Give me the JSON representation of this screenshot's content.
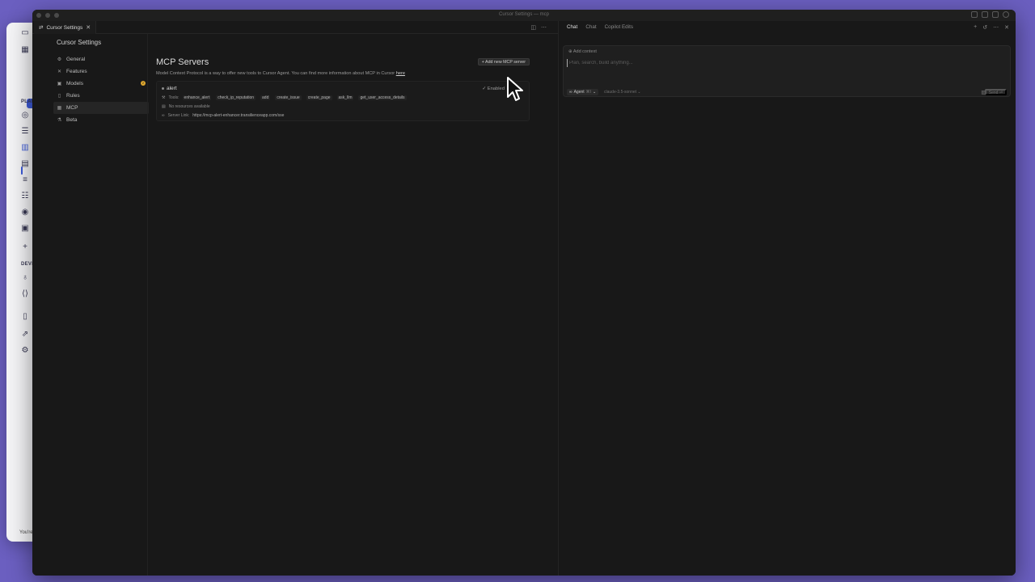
{
  "window": {
    "title": "Cursor Settings — mcp"
  },
  "editor": {
    "tab_label": "Cursor Settings",
    "tab_close": "✕"
  },
  "settings": {
    "title": "Cursor Settings",
    "nav": [
      {
        "label": "General",
        "icon": "gear-icon"
      },
      {
        "label": "Features",
        "icon": "tools-icon"
      },
      {
        "label": "Models",
        "icon": "cube-icon",
        "badge": "2"
      },
      {
        "label": "Rules",
        "icon": "rules-icon"
      },
      {
        "label": "MCP",
        "icon": "server-icon",
        "active": true
      },
      {
        "label": "Beta",
        "icon": "flask-icon"
      }
    ],
    "mcp": {
      "heading": "MCP Servers",
      "description": "Model Context Protocol is a way to offer new tools to Cursor Agent. You can find more information about MCP in Cursor ",
      "description_link": "here",
      "add_button": "+ Add new MCP server",
      "server": {
        "name": "alert",
        "status": "✓ Enabled",
        "tools_label": "Tools:",
        "tools": [
          "enhance_alert",
          "check_ip_reputation",
          "add",
          "create_issue",
          "create_page",
          "ask_llm",
          "get_user_access_details"
        ],
        "resources_text": "No resources available",
        "link_label": "Server Link:",
        "link": "https://mcp-alert-enhancer.transilienceapp.com/sse"
      }
    }
  },
  "chat": {
    "tabs": [
      "Chat",
      "Chat",
      "Copilot Edits"
    ],
    "add_context": "Add context",
    "input_placeholder": "Plan, search, build anything...",
    "agent_label": "Agent",
    "agent_shortcut": "⌘I",
    "model": "claude-3.5-sonnet",
    "send_label": "Send ⏎"
  },
  "background_app": {
    "section_1": "PLAN",
    "section_2": "DEVE",
    "footer": "You're"
  }
}
